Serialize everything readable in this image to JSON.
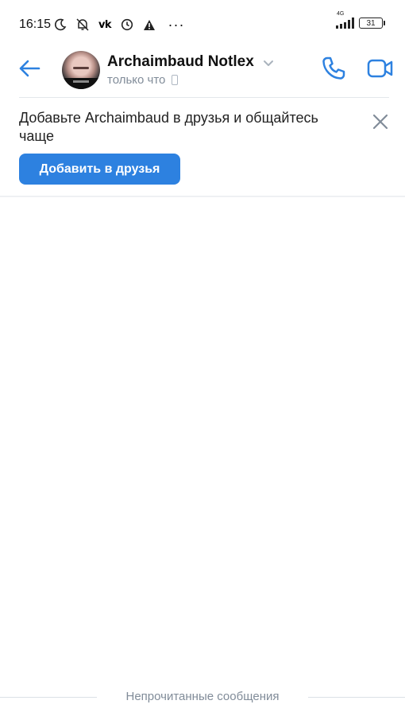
{
  "status_bar": {
    "time": "16:15",
    "network_label": "4G",
    "battery": "31",
    "vk_label": "vk",
    "more": "···"
  },
  "header": {
    "contact_name": "Archaimbaud Notlex",
    "contact_status": "только что"
  },
  "friend_suggestion": {
    "text": "Добавьте Archaimbaud в друзья и общайтесь чаще",
    "add_button_label": "Добавить в друзья"
  },
  "unread_separator": {
    "label": "Непрочитанные сообщения"
  },
  "colors": {
    "accent": "#2d81e0",
    "secondary_text": "#818c99",
    "divider": "#e4e7eb"
  },
  "icons": [
    "moon-icon",
    "bell-off-icon",
    "vk-icon",
    "alarm-icon",
    "warning-icon",
    "back-arrow-icon",
    "chevron-down-icon",
    "phone-icon",
    "video-camera-icon",
    "close-icon",
    "mobile-device-icon"
  ]
}
